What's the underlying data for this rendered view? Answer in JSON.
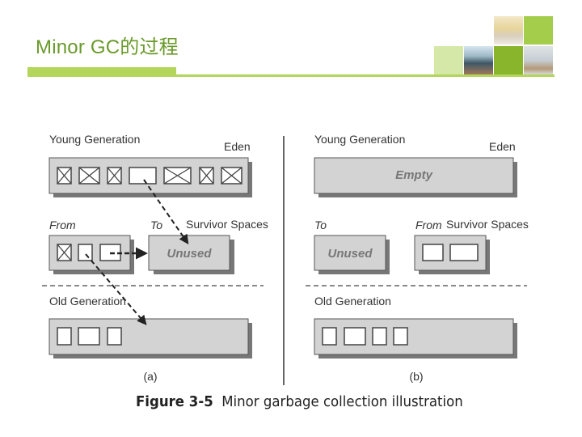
{
  "slide": {
    "title": "Minor GC的过程",
    "accent_color": "#b3d65a",
    "title_color": "#6a9a2a"
  },
  "decor": {
    "tiles": [
      "light-green",
      "photo-reception",
      "bright-green",
      "photo-classroom",
      "dark-green",
      "photo-office"
    ]
  },
  "figure": {
    "caption_label": "Figure 3-5",
    "caption_text": "Minor garbage collection illustration",
    "panel_a": {
      "label": "(a)",
      "young_generation_label": "Young Generation",
      "eden_label": "Eden",
      "eden_objects": [
        "dead",
        "dead",
        "dead",
        "live",
        "dead",
        "dead",
        "dead"
      ],
      "from_label": "From",
      "to_label": "To",
      "survivor_label": "Survivor Spaces",
      "from_objects": [
        "dead",
        "live",
        "live"
      ],
      "to_text": "Unused",
      "old_generation_label": "Old Generation",
      "old_objects": [
        "live",
        "live",
        "live"
      ]
    },
    "panel_b": {
      "label": "(b)",
      "young_generation_label": "Young Generation",
      "eden_label": "Eden",
      "eden_text": "Empty",
      "to_label": "To",
      "from_label": "From",
      "survivor_label": "Survivor Spaces",
      "to_text": "Unused",
      "from_objects": [
        "live",
        "live"
      ],
      "old_generation_label": "Old Generation",
      "old_objects": [
        "live",
        "live",
        "live",
        "live"
      ]
    }
  }
}
